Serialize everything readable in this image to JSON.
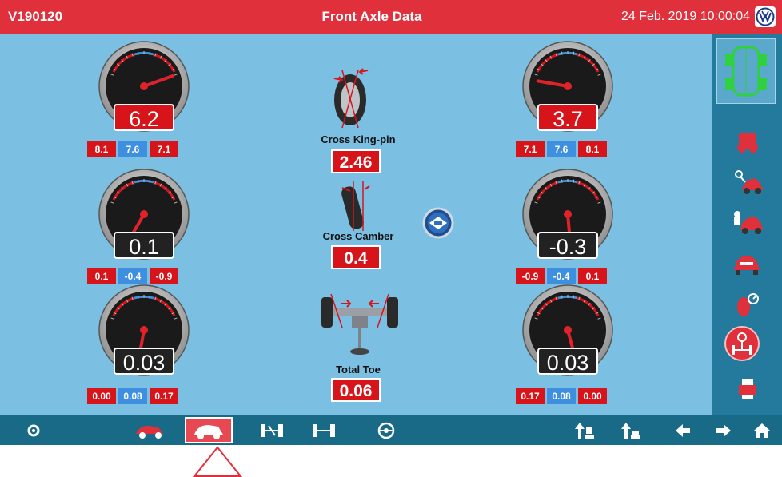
{
  "header": {
    "vehicle_id": "V190120",
    "title": "Front Axle Data",
    "datetime": "24 Feb. 2019 10:00:04",
    "brand_icon": "vw-logo-icon"
  },
  "gauges": {
    "left_top": {
      "value": "6.2",
      "style": "red",
      "values": [
        "8.1",
        "7.6",
        "7.1"
      ]
    },
    "left_mid": {
      "value": "0.1",
      "style": "black",
      "values": [
        "0.1",
        "-0.4",
        "-0.9"
      ]
    },
    "left_bot": {
      "value": "0.03",
      "style": "black",
      "values": [
        "0.00",
        "0.08",
        "0.17"
      ]
    },
    "right_top": {
      "value": "3.7",
      "style": "red",
      "values": [
        "7.1",
        "7.6",
        "8.1"
      ]
    },
    "right_mid": {
      "value": "-0.3",
      "style": "black",
      "values": [
        "-0.9",
        "-0.4",
        "0.1"
      ]
    },
    "right_bot": {
      "value": "0.03",
      "style": "black",
      "values": [
        "0.17",
        "0.08",
        "0.00"
      ]
    }
  },
  "center": {
    "kingpin": {
      "label": "Cross King-pin",
      "value": "2.46"
    },
    "camber": {
      "label": "Cross Camber",
      "value": "0.4"
    },
    "toe": {
      "label": "Total Toe",
      "value": "0.06"
    }
  },
  "sidebar_icons": [
    "car-wheels-top-view-icon",
    "car-lift-icon",
    "key-car-icon",
    "car-mechanic-icon",
    "car-front-icon",
    "tire-gauge-icon",
    "steering-axle-icon",
    "printer-icon"
  ],
  "bottombar_icons": [
    "settings-icon",
    "car-side-icon",
    "car-active-icon",
    "axle-rear-icon",
    "axle-front-icon",
    "steering-wheel-icon",
    "lift-up-icon",
    "lift-down-icon",
    "arrow-left-icon",
    "arrow-right-icon",
    "home-icon"
  ],
  "colors": {
    "header": "#e0303b",
    "panel": "#7bbfe3",
    "sidebar": "#237a9c",
    "bottombar": "#196a86",
    "value_red": "#d8141b",
    "value_blue": "#3e8fe0"
  }
}
